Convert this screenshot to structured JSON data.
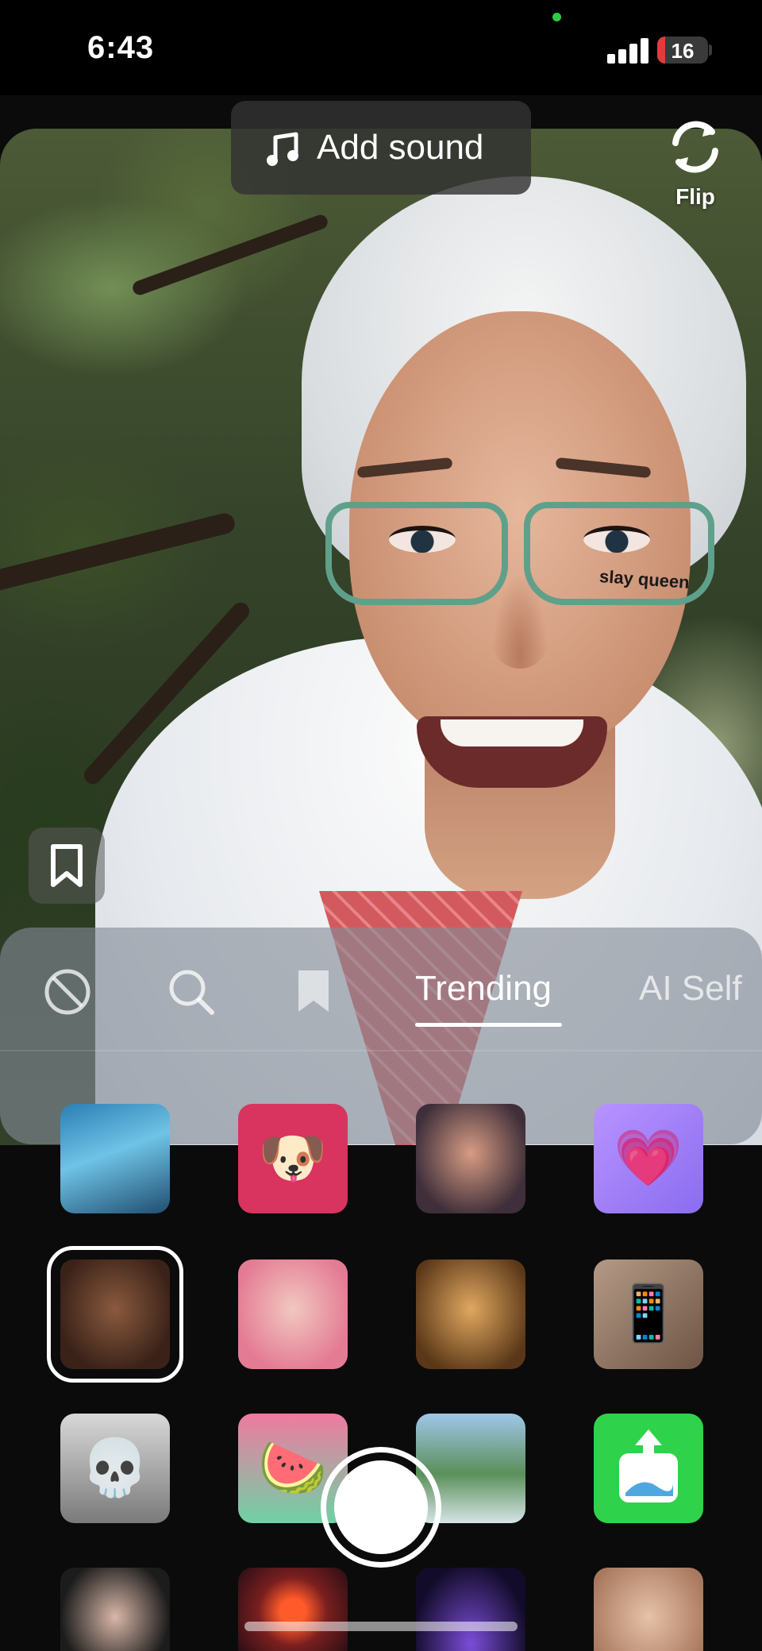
{
  "status_bar": {
    "time": "6:43",
    "battery_level": "16",
    "battery_percent": 16,
    "signal_bars": 4
  },
  "top_controls": {
    "add_sound_label": "Add sound",
    "flip_label": "Flip"
  },
  "camera": {
    "cheek_sticker_text": "slay queen"
  },
  "effects_tabs": [
    {
      "type": "icon",
      "icon": "no-effect-icon"
    },
    {
      "type": "icon",
      "icon": "search-icon"
    },
    {
      "type": "icon",
      "icon": "bookmark-icon"
    },
    {
      "type": "text",
      "label": "Trending",
      "selected": true
    },
    {
      "type": "text",
      "label": "AI Self"
    }
  ],
  "effects": [
    {
      "icon": "waterfall-effect",
      "selected": false
    },
    {
      "icon": "dog-quiz-effect",
      "selected": false
    },
    {
      "icon": "glam-portrait-effect",
      "selected": false
    },
    {
      "icon": "heart-pose-effect",
      "selected": false
    },
    {
      "icon": "slay-queen-effect",
      "selected": true
    },
    {
      "icon": "pink-hair-effect",
      "selected": false
    },
    {
      "icon": "golden-skin-effect",
      "selected": false
    },
    {
      "icon": "green-screen-phone-effect",
      "selected": false
    },
    {
      "icon": "white-mask-effect",
      "selected": false
    },
    {
      "icon": "watermelon-face-effect",
      "selected": false
    },
    {
      "icon": "mountain-river-effect",
      "selected": false
    },
    {
      "icon": "upload-image-effect",
      "selected": false
    },
    {
      "icon": "dark-hair-portrait-effect",
      "selected": false
    },
    {
      "icon": "sunset-effect",
      "selected": false
    },
    {
      "icon": "night-scene-effect",
      "selected": false
    },
    {
      "icon": "close-up-face-effect",
      "selected": false
    }
  ],
  "colors": {
    "accent": "#ffffff",
    "battery_low": "#e23b3b",
    "mic_indicator": "#2ecc40",
    "upload_green": "#2fd24b"
  }
}
